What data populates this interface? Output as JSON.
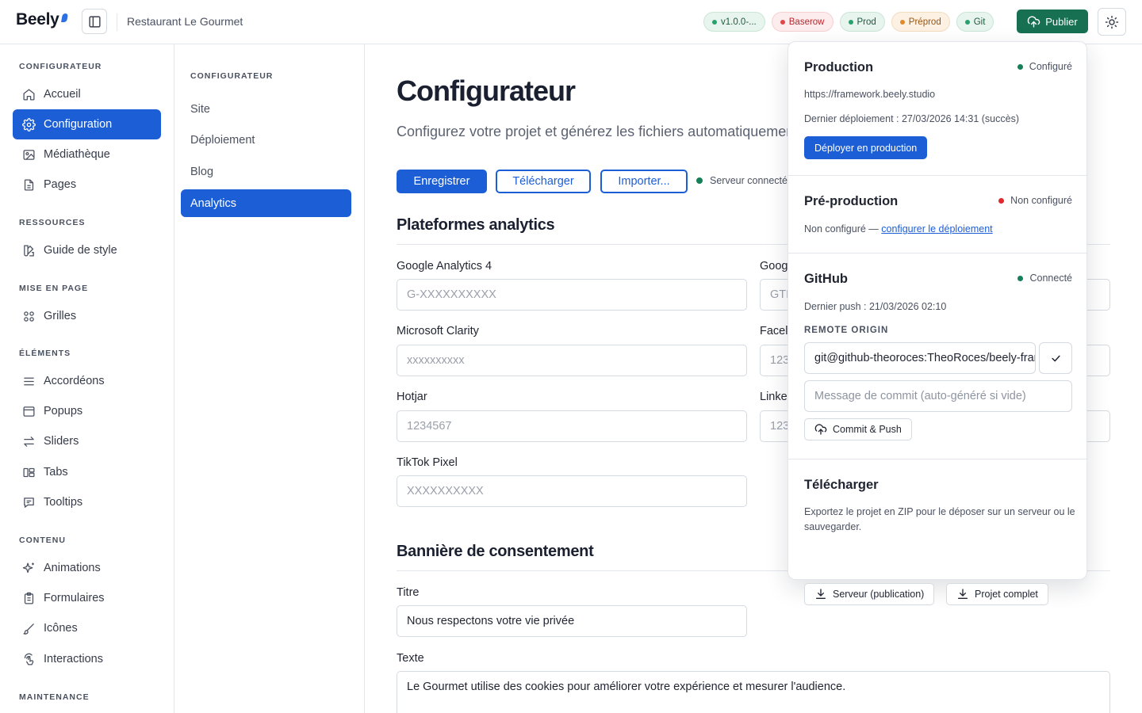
{
  "header": {
    "logo": "Beely",
    "project_name": "Restaurant Le Gourmet",
    "badges": [
      {
        "label": "v1.0.0-...",
        "dot": "#29a06e",
        "bg": "#e8f4ee",
        "border": "#c9e6d6",
        "color": "#1f5a3e"
      },
      {
        "label": "Baserow",
        "dot": "#e0474c",
        "bg": "#fdeced",
        "border": "#f6cfd1",
        "color": "#b5282d"
      },
      {
        "label": "Prod",
        "dot": "#29a06e",
        "bg": "#e8f4ee",
        "border": "#c9e6d6",
        "color": "#1f5a3e"
      },
      {
        "label": "Préprod",
        "dot": "#e08a2e",
        "bg": "#fdf1e4",
        "border": "#f4dcbf",
        "color": "#9a5410"
      },
      {
        "label": "Git",
        "dot": "#29a06e",
        "bg": "#e8f4ee",
        "border": "#c9e6d6",
        "color": "#1f5a3e"
      }
    ],
    "publish_label": "Publier"
  },
  "sidebar": {
    "sections": [
      {
        "title": "CONFIGURATEUR",
        "items": [
          {
            "label": "Accueil",
            "icon": "home-icon"
          },
          {
            "label": "Configuration",
            "icon": "gear-icon",
            "active": true
          },
          {
            "label": "Médiathèque",
            "icon": "image-icon"
          },
          {
            "label": "Pages",
            "icon": "file-icon"
          }
        ]
      },
      {
        "title": "RESSOURCES",
        "items": [
          {
            "label": "Guide de style",
            "icon": "palette-icon"
          }
        ]
      },
      {
        "title": "MISE EN PAGE",
        "items": [
          {
            "label": "Grilles",
            "icon": "grid-icon"
          }
        ]
      },
      {
        "title": "ÉLÉMENTS",
        "items": [
          {
            "label": "Accordéons",
            "icon": "list-icon"
          },
          {
            "label": "Popups",
            "icon": "window-icon"
          },
          {
            "label": "Sliders",
            "icon": "arrows-icon"
          },
          {
            "label": "Tabs",
            "icon": "tabs-icon"
          },
          {
            "label": "Tooltips",
            "icon": "message-icon"
          }
        ]
      },
      {
        "title": "CONTENU",
        "items": [
          {
            "label": "Animations",
            "icon": "sparkles-icon"
          },
          {
            "label": "Formulaires",
            "icon": "clipboard-icon"
          },
          {
            "label": "Icônes",
            "icon": "brush-icon"
          },
          {
            "label": "Interactions",
            "icon": "pointer-icon"
          }
        ]
      },
      {
        "title": "MAINTENANCE",
        "items": []
      }
    ]
  },
  "subnav": {
    "title": "CONFIGURATEUR",
    "items": [
      {
        "label": "Site"
      },
      {
        "label": "Déploiement"
      },
      {
        "label": "Blog"
      },
      {
        "label": "Analytics",
        "active": true
      }
    ]
  },
  "main": {
    "title": "Configurateur",
    "subtitle": "Configurez votre projet et générez les fichiers automatiquement",
    "buttons": {
      "save": "Enregistrer",
      "download": "Télécharger",
      "import": "Importer..."
    },
    "server_status": "Serveur connecté",
    "analytics_heading": "Plateformes analytics",
    "fields_left": [
      {
        "label": "Google Analytics 4",
        "placeholder": "G-XXXXXXXXXX"
      },
      {
        "label": "Microsoft Clarity",
        "placeholder": "xxxxxxxxxx"
      },
      {
        "label": "Hotjar",
        "placeholder": "1234567"
      },
      {
        "label": "TikTok Pixel",
        "placeholder": "XXXXXXXXXX"
      }
    ],
    "fields_right": [
      {
        "label": "Goog",
        "placeholder": "GTI"
      },
      {
        "label": "Facel",
        "placeholder": "123"
      },
      {
        "label": "Linke",
        "placeholder": "123"
      }
    ],
    "consent_heading": "Bannière de consentement",
    "consent_title_label": "Titre",
    "consent_title_value": "Nous respectons votre vie privée",
    "consent_text_label": "Texte",
    "consent_text_value": "Le Gourmet utilise des cookies pour améliorer votre expérience et mesurer l'audience."
  },
  "popover": {
    "production": {
      "title": "Production",
      "status": "Configuré",
      "status_color": "#15805a",
      "url": "https://framework.beely.studio",
      "last_deploy": "Dernier déploiement : 27/03/2026 14:31 (succès)",
      "button": "Déployer en production"
    },
    "preproduction": {
      "title": "Pré-production",
      "status": "Non configuré",
      "status_color": "#e0282d",
      "text": "Non configuré —",
      "link": "configurer le déploiement"
    },
    "github": {
      "title": "GitHub",
      "status": "Connecté",
      "status_color": "#15805a",
      "last_push": "Dernier push : 21/03/2026 02:10",
      "remote_label": "REMOTE ORIGIN",
      "remote_value": "git@github-theoroces:TheoRoces/beely-framework.git",
      "commit_placeholder": "Message de commit (auto-généré si vide)",
      "commit_button": "Commit & Push"
    },
    "download": {
      "title": "Télécharger",
      "description": "Exportez le projet en ZIP pour le déposer sur un serveur ou le sauvegarder.",
      "server_button": "Serveur (publication)",
      "full_button": "Projet complet"
    }
  }
}
